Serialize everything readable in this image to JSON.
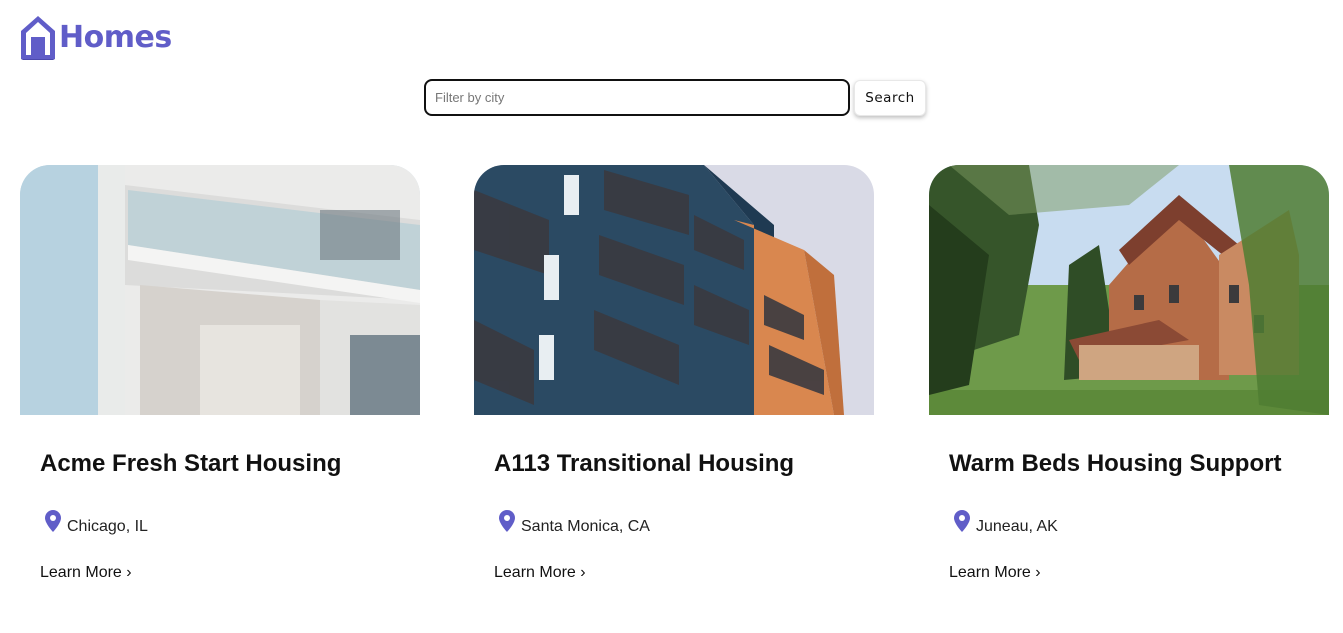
{
  "brand": {
    "name": "Homes",
    "logo_icon": "house-icon",
    "color": "#605DC8"
  },
  "search": {
    "placeholder": "Filter by city",
    "value": "",
    "button_label": "Search"
  },
  "listings": [
    {
      "title": "Acme Fresh Start Housing",
      "location": "Chicago, IL",
      "link_label": "Learn More ›",
      "photo": "modern-white-apartment-balconies"
    },
    {
      "title": "A113 Transitional Housing",
      "location": "Santa Monica, CA",
      "link_label": "Learn More ›",
      "photo": "blue-orange-apartment-balconies"
    },
    {
      "title": "Warm Beds Housing Support",
      "location": "Juneau, AK",
      "link_label": "Learn More ›",
      "photo": "victorian-house-with-lawn"
    }
  ],
  "icons": {
    "location": "map-pin-icon"
  },
  "colors": {
    "accent": "#605DC8",
    "text": "#111111"
  }
}
